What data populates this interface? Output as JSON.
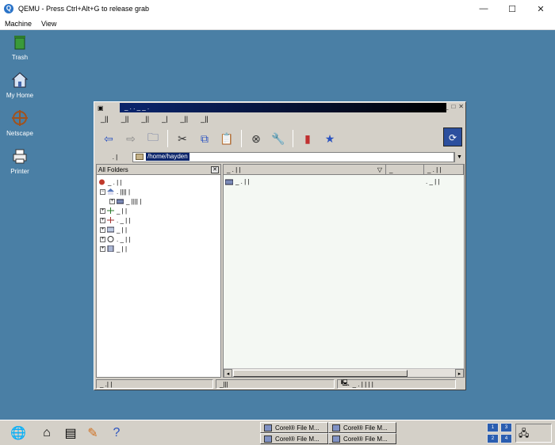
{
  "host": {
    "title": "QEMU - Press Ctrl+Alt+G to release grab",
    "logo_letter": "Q",
    "menu": [
      "Machine",
      "View"
    ],
    "controls": [
      "—",
      "☐",
      "✕"
    ]
  },
  "desktop": {
    "icons": [
      {
        "label": "Trash",
        "icon": "trash-icon"
      },
      {
        "label": "My Home",
        "icon": "home-icon"
      },
      {
        "label": "Netscape",
        "icon": "netscape-icon"
      },
      {
        "label": "Printer",
        "icon": "printer-icon"
      }
    ]
  },
  "file_manager": {
    "title": "_ . . _ _ .",
    "title_controls": [
      "_",
      "□",
      "✕"
    ],
    "menu": [
      "_||",
      "_||",
      "_||",
      "_|",
      "_||",
      "_||"
    ],
    "location_label": ". |",
    "location_path": "/home/hayden",
    "tree_header": "All Folders",
    "tree_items": [
      {
        "text": "_ .  |  |",
        "expander": ""
      },
      {
        "text": ". ||||  |",
        "expander": "−"
      },
      {
        "text": "_ ||||  |",
        "expander": "+"
      },
      {
        "text": "_ |   |",
        "expander": "+"
      },
      {
        "text": ". _ |   |",
        "expander": "+"
      },
      {
        "text": "_ | |",
        "expander": "+"
      },
      {
        "text": ". _  |  |",
        "expander": "+"
      },
      {
        "text": "_ | |",
        "expander": "+"
      }
    ],
    "list_headers": [
      "_ .  | |",
      "_",
      "_ .  |  |"
    ],
    "list_rows": [
      {
        "name": "_ .  | |",
        "size": ". _ |  |"
      }
    ],
    "status": [
      "_ .| |",
      "_|||",
      "_ .  | | | |"
    ]
  },
  "taskbar": {
    "tasks": [
      "Corel® File M...",
      "Corel® File M...",
      "Corel® File M...",
      "Corel® File M..."
    ],
    "pager": [
      "1",
      "3",
      "2",
      "4"
    ]
  }
}
